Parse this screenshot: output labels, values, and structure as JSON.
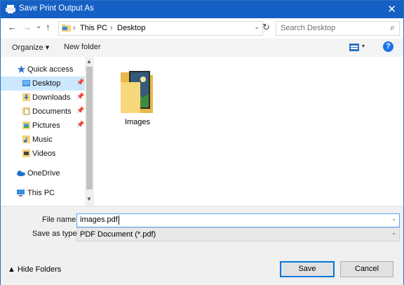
{
  "window": {
    "title": "Save Print Output As",
    "close_glyph": "✕"
  },
  "nav": {
    "back_glyph": "←",
    "forward_glyph": "→",
    "down_glyph": "⌄",
    "up_glyph": "↑"
  },
  "address": {
    "segments": [
      "This PC",
      "Desktop"
    ],
    "separator_glyph": "›",
    "dropdown_glyph": "⌄",
    "refresh_glyph": "↻"
  },
  "search": {
    "placeholder": "Search Desktop",
    "icon_glyph": "⌕"
  },
  "toolbar": {
    "organize_label": "Organize ▾",
    "new_folder_label": "New folder",
    "view_dd_glyph": "▾",
    "help_glyph": "?"
  },
  "sidebar": {
    "pin_glyph": "📌",
    "items": [
      {
        "label": "Quick access",
        "icon": "star-icon"
      },
      {
        "label": "Desktop",
        "icon": "desktop-icon",
        "selected": true
      },
      {
        "label": "Downloads",
        "icon": "downloads-icon"
      },
      {
        "label": "Documents",
        "icon": "documents-icon"
      },
      {
        "label": "Pictures",
        "icon": "pictures-icon"
      },
      {
        "label": "Music",
        "icon": "music-icon"
      },
      {
        "label": "Videos",
        "icon": "videos-icon"
      },
      {
        "label": "OneDrive",
        "icon": "onedrive-icon"
      },
      {
        "label": "This PC",
        "icon": "pc-icon"
      }
    ],
    "scroll_up_glyph": "▲",
    "scroll_down_glyph": "▼"
  },
  "content": {
    "items": [
      {
        "label": "Images",
        "icon": "folder-icon"
      }
    ]
  },
  "form": {
    "file_name_label": "File name:",
    "file_name_value": "images.pdf",
    "save_as_type_label": "Save as type:",
    "save_as_type_value": "PDF Document (*.pdf)",
    "dropdown_glyph": "⌄"
  },
  "footer": {
    "hide_folders_label": "▲  Hide Folders",
    "save_label": "Save",
    "cancel_label": "Cancel"
  },
  "colors": {
    "title_bar": "#1560c4",
    "selection": "#cce8ff",
    "accent": "#0078d7"
  }
}
